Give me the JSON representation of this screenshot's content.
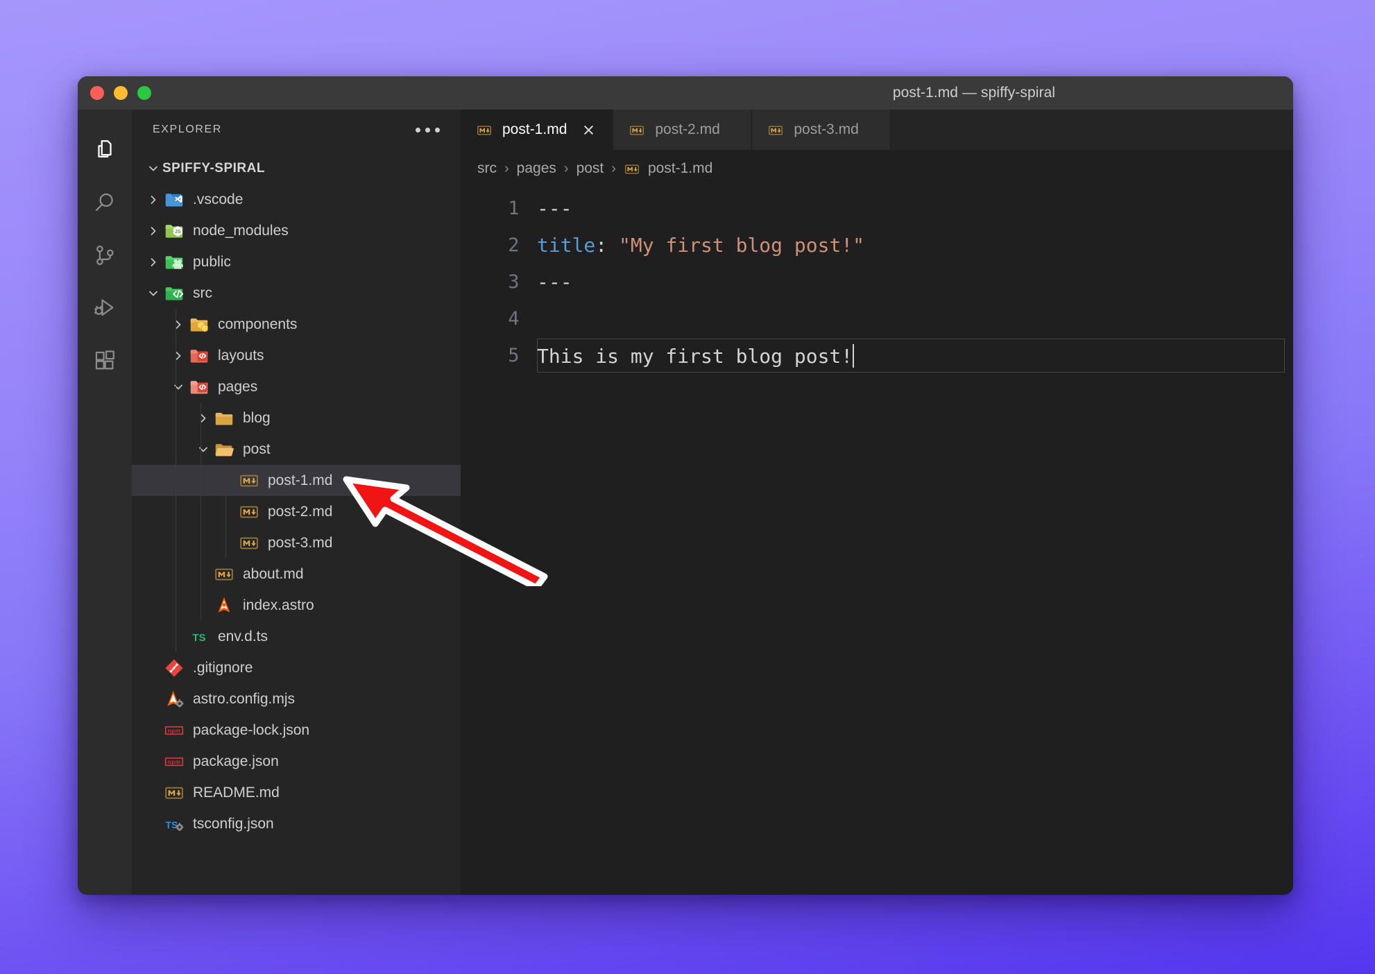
{
  "window": {
    "title": "post-1.md — spiffy-spiral",
    "traffic_lights": [
      "close-red",
      "minimize-yellow",
      "maximize-green"
    ],
    "colors": {
      "desktop_top": "#a596fb",
      "desktop_bottom": "#5436ef",
      "titlebar": "#3a3a3a",
      "activity_bar": "#2c2c2c",
      "sidebar": "#252526",
      "editor": "#1f1f1f",
      "tab_active": "#1f1f1f",
      "tab_inactive": "#2d2d2d",
      "selected_row": "#37373d",
      "accent_blue": "#569cd6",
      "accent_string": "#ce9178",
      "arrow_red": "#f01414"
    }
  },
  "activity_bar": {
    "items": [
      {
        "name": "explorer-icon",
        "label": "Explorer",
        "active": true
      },
      {
        "name": "search-icon",
        "label": "Search",
        "active": false
      },
      {
        "name": "source-control-icon",
        "label": "Source Control",
        "active": false
      },
      {
        "name": "run-debug-icon",
        "label": "Run and Debug",
        "active": false
      },
      {
        "name": "extensions-icon",
        "label": "Extensions",
        "active": false
      }
    ]
  },
  "sidebar": {
    "title": "EXPLORER",
    "more_actions": "…",
    "tree": [
      {
        "label": "SPIFFY-SPIRAL",
        "depth": 0,
        "kind": "root",
        "state": "expanded",
        "icon": "none"
      },
      {
        "label": ".vscode",
        "depth": 1,
        "kind": "folder",
        "state": "collapsed",
        "icon": "folder-vscode"
      },
      {
        "label": "node_modules",
        "depth": 1,
        "kind": "folder",
        "state": "collapsed",
        "icon": "folder-node"
      },
      {
        "label": "public",
        "depth": 1,
        "kind": "folder",
        "state": "collapsed",
        "icon": "folder-public"
      },
      {
        "label": "src",
        "depth": 1,
        "kind": "folder",
        "state": "expanded",
        "icon": "folder-src"
      },
      {
        "label": "components",
        "depth": 2,
        "kind": "folder",
        "state": "collapsed",
        "icon": "folder-components"
      },
      {
        "label": "layouts",
        "depth": 2,
        "kind": "folder",
        "state": "collapsed",
        "icon": "folder-layouts"
      },
      {
        "label": "pages",
        "depth": 2,
        "kind": "folder",
        "state": "expanded",
        "icon": "folder-pages"
      },
      {
        "label": "blog",
        "depth": 3,
        "kind": "folder",
        "state": "collapsed",
        "icon": "folder-plain"
      },
      {
        "label": "post",
        "depth": 3,
        "kind": "folder",
        "state": "expanded",
        "icon": "folder-open"
      },
      {
        "label": "post-1.md",
        "depth": 4,
        "kind": "file",
        "state": "none",
        "icon": "markdown",
        "selected": true
      },
      {
        "label": "post-2.md",
        "depth": 4,
        "kind": "file",
        "state": "none",
        "icon": "markdown"
      },
      {
        "label": "post-3.md",
        "depth": 4,
        "kind": "file",
        "state": "none",
        "icon": "markdown"
      },
      {
        "label": "about.md",
        "depth": 3,
        "kind": "file",
        "state": "none",
        "icon": "markdown"
      },
      {
        "label": "index.astro",
        "depth": 3,
        "kind": "file",
        "state": "none",
        "icon": "astro"
      },
      {
        "label": "env.d.ts",
        "depth": 2,
        "kind": "file",
        "state": "none",
        "icon": "typescript"
      },
      {
        "label": ".gitignore",
        "depth": 1,
        "kind": "file",
        "state": "none",
        "icon": "git"
      },
      {
        "label": "astro.config.mjs",
        "depth": 1,
        "kind": "file",
        "state": "none",
        "icon": "astro-config"
      },
      {
        "label": "package-lock.json",
        "depth": 1,
        "kind": "file",
        "state": "none",
        "icon": "npm"
      },
      {
        "label": "package.json",
        "depth": 1,
        "kind": "file",
        "state": "none",
        "icon": "npm"
      },
      {
        "label": "README.md",
        "depth": 1,
        "kind": "file",
        "state": "none",
        "icon": "markdown"
      },
      {
        "label": "tsconfig.json",
        "depth": 1,
        "kind": "file",
        "state": "none",
        "icon": "tsconfig"
      }
    ]
  },
  "editor": {
    "tabs": [
      {
        "label": "post-1.md",
        "icon": "markdown",
        "active": true,
        "closable": true
      },
      {
        "label": "post-2.md",
        "icon": "markdown",
        "active": false,
        "closable": false
      },
      {
        "label": "post-3.md",
        "icon": "markdown",
        "active": false,
        "closable": false
      }
    ],
    "breadcrumb": [
      "src",
      "pages",
      "post",
      "post-1.md"
    ],
    "breadcrumb_separator": "›",
    "breadcrumb_file_icon": "markdown",
    "language": "markdown",
    "current_line": 5,
    "cursor_column": 25,
    "lines": [
      {
        "n": "1",
        "tokens": [
          {
            "t": "hr",
            "v": "---"
          }
        ]
      },
      {
        "n": "2",
        "tokens": [
          {
            "t": "key",
            "v": "title"
          },
          {
            "t": "punct",
            "v": ":"
          },
          {
            "t": "plain",
            "v": " "
          },
          {
            "t": "str",
            "v": "\"My first blog post!\""
          }
        ]
      },
      {
        "n": "3",
        "tokens": [
          {
            "t": "hr",
            "v": "---"
          }
        ]
      },
      {
        "n": "4",
        "tokens": []
      },
      {
        "n": "5",
        "tokens": [
          {
            "t": "plain",
            "v": "This is my first blog post!"
          }
        ]
      }
    ]
  },
  "annotation": {
    "type": "arrow",
    "points_to": "post-1.md",
    "direction": "up-left",
    "fill": "#f01414",
    "outline": "#ffffff"
  }
}
